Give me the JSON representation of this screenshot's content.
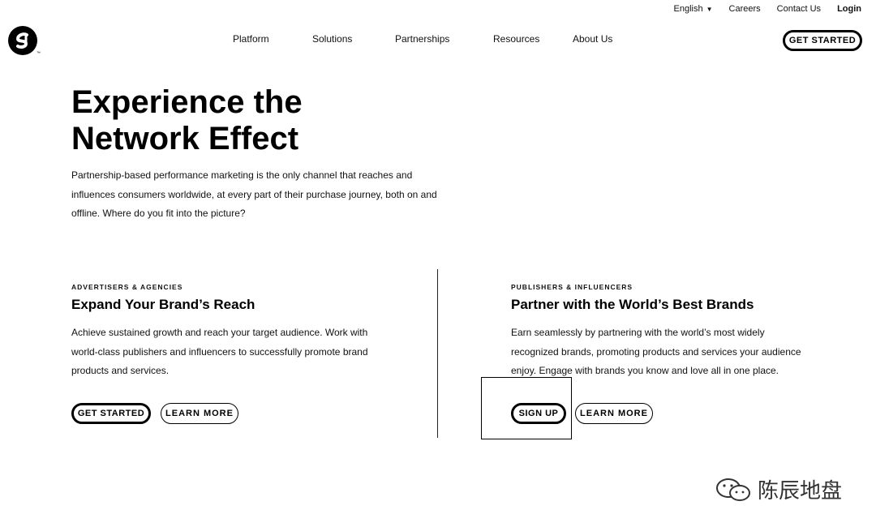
{
  "topbar": {
    "language": "English",
    "careers": "Careers",
    "contact": "Contact Us",
    "login": "Login"
  },
  "nav": {
    "items": [
      "Platform",
      "Solutions",
      "Partnerships",
      "Resources",
      "About Us"
    ],
    "cta": "GET STARTED"
  },
  "hero": {
    "title_line1": "Experience the",
    "title_line2": "Network Effect",
    "body": "Partnership-based performance marketing is the only channel that reaches and influences consumers worldwide, at every part of their purchase journey, both on and offline. Where do you fit into the picture?"
  },
  "advertisers": {
    "eyebrow": "ADVERTISERS & AGENCIES",
    "title": "Expand Your Brand’s Reach",
    "body": "Achieve sustained growth and reach your target audience. Work with world-class publishers and influencers to successfully promote brand products and services.",
    "primary": "GET STARTED",
    "secondary": "LEARN MORE"
  },
  "publishers": {
    "eyebrow": "PUBLISHERS & INFLUENCERS",
    "title": "Partner with the World’s Best Brands",
    "body": "Earn seamlessly by partnering with the world’s most widely recognized brands, promoting products and services your audience enjoy. Engage with brands you know and love all in one place.",
    "primary": "SIGN UP",
    "secondary": "LEARN MORE"
  },
  "watermark": {
    "text": "陈辰地盘"
  },
  "colors": {
    "text": "#111111",
    "background": "#ffffff",
    "accent": "#000000"
  }
}
